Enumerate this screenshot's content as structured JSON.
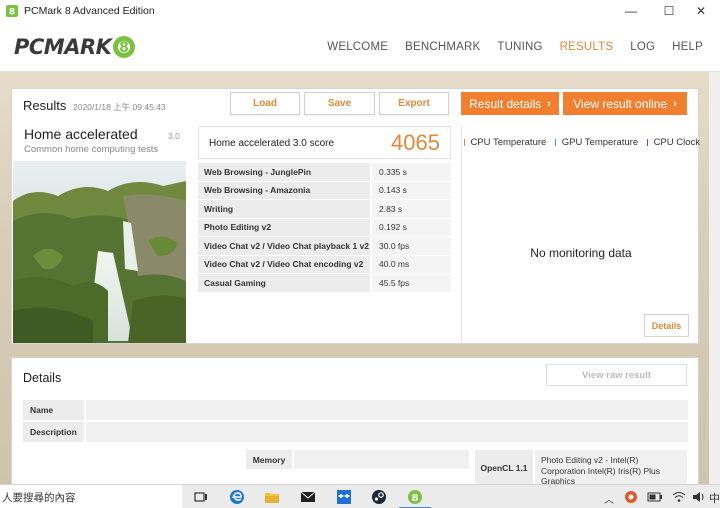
{
  "window": {
    "title": "PCMark 8 Advanced Edition",
    "controls": {
      "minimize": "—",
      "maximize": "☐",
      "close": "✕"
    }
  },
  "header": {
    "logo_text": "PCMARK",
    "logo_badge": "8",
    "nav": [
      {
        "label": "WELCOME",
        "active": false
      },
      {
        "label": "BENCHMARK",
        "active": false
      },
      {
        "label": "TUNING",
        "active": false
      },
      {
        "label": "RESULTS",
        "active": true
      },
      {
        "label": "LOG",
        "active": false
      },
      {
        "label": "HELP",
        "active": false
      }
    ]
  },
  "results": {
    "title": "Results",
    "date": "2020/1/18 上午 09:45:43",
    "buttons": {
      "load": "Load",
      "save": "Save",
      "export": "Export"
    },
    "result_details": "Result details",
    "view_online": "View result online",
    "test_name": "Home accelerated",
    "test_subtitle": "Common home computing tests",
    "test_version": "3.0",
    "score_label": "Home accelerated 3.0 score",
    "score_value": "4065",
    "subscores": [
      {
        "name": "Web Browsing - JunglePin",
        "value": "0.335 s"
      },
      {
        "name": "Web Browsing - Amazonia",
        "value": "0.143 s"
      },
      {
        "name": "Writing",
        "value": "2.83 s"
      },
      {
        "name": "Photo Editing v2",
        "value": "0.192 s"
      },
      {
        "name": "Video Chat v2 / Video Chat playback 1 v2",
        "value": "30.0 fps"
      },
      {
        "name": "Video Chat v2 / Video Chat encoding v2",
        "value": "40.0 ms"
      },
      {
        "name": "Casual Gaming",
        "value": "45.5 fps"
      }
    ],
    "monitoring": {
      "legend": [
        {
          "label": "CPU Temperature",
          "color": "#e0893a"
        },
        {
          "label": "GPU Temperature",
          "color": "#3a9bd8"
        },
        {
          "label": "CPU Clock",
          "color": "#8a3ab8"
        }
      ],
      "no_data": "No monitoring data",
      "details_button": "Details"
    }
  },
  "details": {
    "title": "Details",
    "view_raw": "View raw result",
    "name_label": "Name",
    "description_label": "Description",
    "memory_label": "Memory",
    "opencl_label": "OpenCL 1.1",
    "opencl_value": "Photo Editing v2 - Intel(R) Corporation Intel(R) Iris(R) Plus Graphics"
  },
  "taskbar": {
    "search_text": "人要搜尋的內容",
    "tray_ime": "中"
  }
}
